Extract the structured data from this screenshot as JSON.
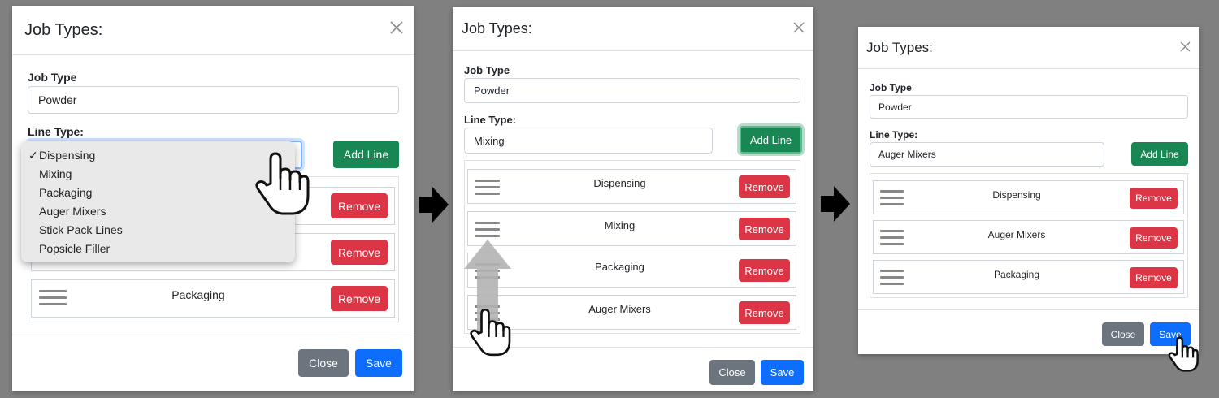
{
  "panels": [
    {
      "title": "Job Types:",
      "job_type_label": "Job Type",
      "job_type_value": "Powder",
      "line_type_label": "Line Type:",
      "add_line_label": "Add Line",
      "dropdown_check": "✓",
      "dropdown_options": [
        "Dispensing",
        "Mixing",
        "Packaging",
        "Auger Mixers",
        "Stick Pack Lines",
        "Popsicle Filler"
      ],
      "dropdown_selected": "Dispensing",
      "lines": [
        "Packaging"
      ],
      "remove_label": "Remove",
      "close_label": "Close",
      "save_label": "Save"
    },
    {
      "title": "Job Types:",
      "job_type_label": "Job Type",
      "job_type_value": "Powder",
      "line_type_label": "Line Type:",
      "line_type_value": "Mixing",
      "add_line_label": "Add Line",
      "lines": [
        "Dispensing",
        "Mixing",
        "Packaging",
        "Auger Mixers"
      ],
      "remove_label": "Remove",
      "close_label": "Close",
      "save_label": "Save"
    },
    {
      "title": "Job Types:",
      "job_type_label": "Job Type",
      "job_type_value": "Powder",
      "line_type_label": "Line Type:",
      "line_type_value": "Auger Mixers",
      "add_line_label": "Add Line",
      "lines": [
        "Dispensing",
        "Auger Mixers",
        "Packaging"
      ],
      "remove_label": "Remove",
      "close_label": "Close",
      "save_label": "Save"
    }
  ],
  "colors": {
    "background": "#808080",
    "add_line": "#198754",
    "remove": "#dc3545",
    "close": "#6c757d",
    "save": "#0d6efd"
  },
  "icons": [
    "close-icon",
    "drag-handle-icon",
    "pointer-hand-icon",
    "right-arrow-icon",
    "up-arrow-icon"
  ]
}
